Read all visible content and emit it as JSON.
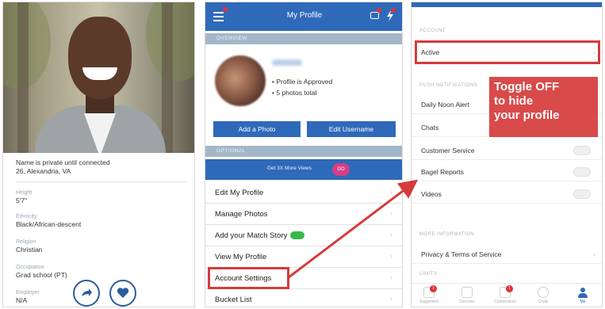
{
  "profile_view": {
    "name_line": "Name is private until connected",
    "location_line": "26, Alexandria, VA",
    "fields": [
      {
        "label": "Height",
        "value": "5'7\""
      },
      {
        "label": "Ethnicity",
        "value": "Black/African-descent"
      },
      {
        "label": "Religion",
        "value": "Christian"
      },
      {
        "label": "Occupation",
        "value": "Grad school (PT)"
      },
      {
        "label": "Employer",
        "value": "N/A"
      }
    ],
    "actions": [
      {
        "icon": "share-arrow-icon"
      },
      {
        "icon": "heart-icon"
      }
    ]
  },
  "my_profile": {
    "title": "My Profile",
    "overview_header": "OVERVIEW",
    "status_lines": [
      "• Profile is Approved",
      "• 5 photos total"
    ],
    "add_photo": "Add a Photo",
    "edit_username": "Edit Username",
    "optional_header": "OPTIONAL",
    "promo_text": "Get 3X More Views",
    "promo_button": "GO",
    "menu": [
      {
        "label": "Edit My Profile"
      },
      {
        "label": "Manage Photos"
      },
      {
        "label": "Add your Match Story"
      },
      {
        "label": "View My Profile"
      },
      {
        "label": "Account Settings",
        "highlighted": true
      },
      {
        "label": "Bucket List"
      }
    ],
    "accent": "#2f69b9"
  },
  "account_settings": {
    "account_header": "ACCOUNT",
    "account_status": "Active",
    "push_header": "PUSH NOTIFICATIONS",
    "notifications": [
      {
        "label": "Daily Noon Alert"
      },
      {
        "label": "Chats"
      },
      {
        "label": "Customer Service"
      },
      {
        "label": "Bagel Reports"
      },
      {
        "label": "Videos"
      }
    ],
    "more_header": "MORE INFORMATION",
    "privacy": "Privacy & Terms of Service",
    "limits_header": "LIMITS",
    "callout_lines": [
      "Toggle OFF",
      "to hide",
      "your profile"
    ],
    "callout_color": "#d94a4a",
    "nav": [
      {
        "label": "Suggested",
        "badge": "1"
      },
      {
        "label": "Discover",
        "badge": ""
      },
      {
        "label": "Connections",
        "badge": "1"
      },
      {
        "label": "Chats",
        "badge": ""
      },
      {
        "label": "Me",
        "badge": ""
      }
    ]
  }
}
